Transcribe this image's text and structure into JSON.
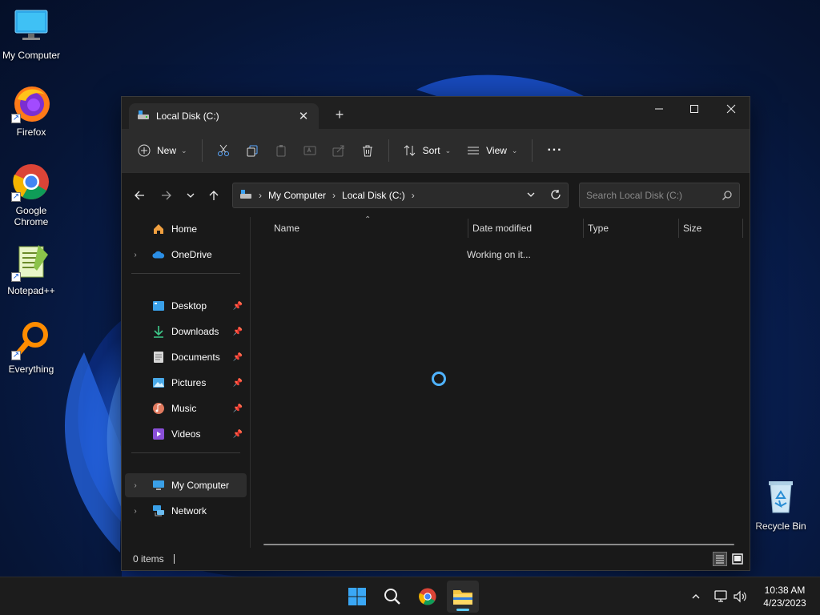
{
  "desktop": {
    "icons": [
      {
        "label": "My Computer"
      },
      {
        "label": "Firefox"
      },
      {
        "label": "Google\nChrome",
        "line1": "Google",
        "line2": "Chrome"
      },
      {
        "label": "Notepad++"
      },
      {
        "label": "Everything"
      },
      {
        "label": "Recycle Bin"
      }
    ]
  },
  "window": {
    "tab_title": "Local Disk (C:)",
    "tab_close": "✕",
    "new_tab": "+",
    "controls": {
      "minimize": "—",
      "maximize": "☐",
      "close": "✕"
    },
    "commandbar": {
      "new_label": "New",
      "sort_label": "Sort",
      "view_label": "View",
      "more_label": "···"
    },
    "address": {
      "crumbs": [
        "My Computer",
        "Local Disk (C:)"
      ],
      "search_placeholder": "Search Local Disk (C:)"
    },
    "navpane": {
      "items": [
        {
          "label": "Home"
        },
        {
          "label": "OneDrive"
        },
        {
          "label": "Desktop",
          "pinned": true
        },
        {
          "label": "Downloads",
          "pinned": true
        },
        {
          "label": "Documents",
          "pinned": true
        },
        {
          "label": "Pictures",
          "pinned": true
        },
        {
          "label": "Music",
          "pinned": true
        },
        {
          "label": "Videos",
          "pinned": true
        },
        {
          "label": "My Computer",
          "selected": true
        },
        {
          "label": "Network"
        }
      ]
    },
    "content": {
      "columns": [
        "Name",
        "Date modified",
        "Type",
        "Size"
      ],
      "status_message": "Working on it..."
    },
    "statusbar": {
      "items_count": "0 items"
    }
  },
  "taskbar": {
    "time": "10:38 AM",
    "date": "4/23/2023"
  },
  "colors": {
    "accent": "#60cdff",
    "window_bg": "#191919",
    "commandbar_bg": "#2c2c2c",
    "taskbar_bg": "#1c1c1c"
  }
}
